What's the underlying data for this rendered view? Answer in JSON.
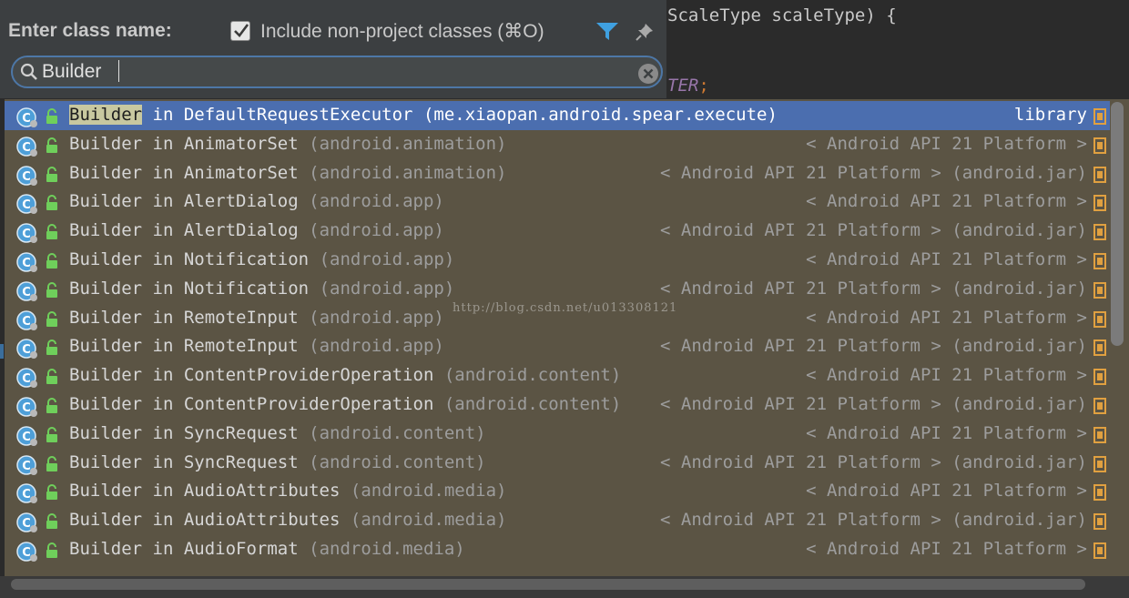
{
  "editor": {
    "line1": "ScaleType scaleType) {",
    "line2_kw": "TER",
    "line2_semi": ";"
  },
  "popup": {
    "prompt": "Enter class name:",
    "include_checked": true,
    "include_label": "Include non-project classes (⌘O)",
    "search_value": "Builder",
    "search_placeholder": ""
  },
  "results": [
    {
      "name": "Builder",
      "sep": " in ",
      "owner": "DefaultRequestExecutor",
      "pkg": "(me.xiaopan.android.spear.execute)",
      "source": "library",
      "selected": true
    },
    {
      "name": "Builder",
      "sep": " in ",
      "owner": "AnimatorSet",
      "pkg": "(android.animation)",
      "source": "< Android API 21 Platform >"
    },
    {
      "name": "Builder",
      "sep": " in ",
      "owner": "AnimatorSet",
      "pkg": "(android.animation)",
      "source": "< Android API 21 Platform > (android.jar)"
    },
    {
      "name": "Builder",
      "sep": " in ",
      "owner": "AlertDialog",
      "pkg": "(android.app)",
      "source": "< Android API 21 Platform >"
    },
    {
      "name": "Builder",
      "sep": " in ",
      "owner": "AlertDialog",
      "pkg": "(android.app)",
      "source": "< Android API 21 Platform > (android.jar)"
    },
    {
      "name": "Builder",
      "sep": " in ",
      "owner": "Notification",
      "pkg": "(android.app)",
      "source": "< Android API 21 Platform >"
    },
    {
      "name": "Builder",
      "sep": " in ",
      "owner": "Notification",
      "pkg": "(android.app)",
      "source": "< Android API 21 Platform > (android.jar)"
    },
    {
      "name": "Builder",
      "sep": " in ",
      "owner": "RemoteInput",
      "pkg": "(android.app)",
      "source": "< Android API 21 Platform >"
    },
    {
      "name": "Builder",
      "sep": " in ",
      "owner": "RemoteInput",
      "pkg": "(android.app)",
      "source": "< Android API 21 Platform > (android.jar)"
    },
    {
      "name": "Builder",
      "sep": " in ",
      "owner": "ContentProviderOperation",
      "pkg": "(android.content)",
      "source": "< Android API 21 Platform >"
    },
    {
      "name": "Builder",
      "sep": " in ",
      "owner": "ContentProviderOperation",
      "pkg": "(android.content)",
      "source": "< Android API 21 Platform > (android.jar)"
    },
    {
      "name": "Builder",
      "sep": " in ",
      "owner": "SyncRequest",
      "pkg": "(android.content)",
      "source": "< Android API 21 Platform >"
    },
    {
      "name": "Builder",
      "sep": " in ",
      "owner": "SyncRequest",
      "pkg": "(android.content)",
      "source": "< Android API 21 Platform > (android.jar)"
    },
    {
      "name": "Builder",
      "sep": " in ",
      "owner": "AudioAttributes",
      "pkg": "(android.media)",
      "source": "< Android API 21 Platform >"
    },
    {
      "name": "Builder",
      "sep": " in ",
      "owner": "AudioAttributes",
      "pkg": "(android.media)",
      "source": "< Android API 21 Platform > (android.jar)"
    },
    {
      "name": "Builder",
      "sep": " in ",
      "owner": "AudioFormat",
      "pkg": "(android.media)",
      "source": "< Android API 21 Platform >"
    }
  ],
  "watermark": "http://blog.csdn.net/u013308121",
  "colors": {
    "popup_bg": "#3c3f41",
    "list_bg": "#5b5444",
    "selection": "#4b6eaf",
    "filter_icon": "#3fa0e0"
  }
}
